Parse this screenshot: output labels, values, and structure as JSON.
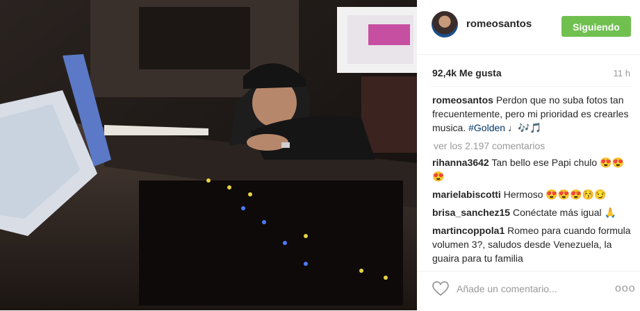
{
  "post": {
    "username": "romeosantos",
    "follow_label": "Siguiendo",
    "likes": "92,4k Me gusta",
    "time": "11 h",
    "caption_user": "romeosantos",
    "caption_text": "Perdon que no suba fotos tan frecuentemente, pero mi prioridad es crearles musica. ",
    "caption_tag": "#Golden",
    "caption_emoji": "♩🎶🎵",
    "view_all": "ver los 2.197 comentarios",
    "comments": [
      {
        "user": "rihanna3642",
        "text": "Tan bello ese Papi chulo 😍😍😍"
      },
      {
        "user": "marielabiscotti",
        "text": "Hermoso 😍😍😍😚😏"
      },
      {
        "user": "brisa_sanchez15",
        "text": "Conéctate más igual 🙏"
      },
      {
        "user": "martincoppola1",
        "text": "Romeo para cuando formula volumen 3?, saludos desde Venezuela, la guaira para tu familia"
      }
    ],
    "add_comment_placeholder": "Añade un comentario...",
    "more_label": "ooo"
  },
  "colors": {
    "follow_button": "#70c050",
    "tag": "#003569"
  },
  "icons": {
    "like": "heart-icon",
    "options": "more-options-icon"
  }
}
